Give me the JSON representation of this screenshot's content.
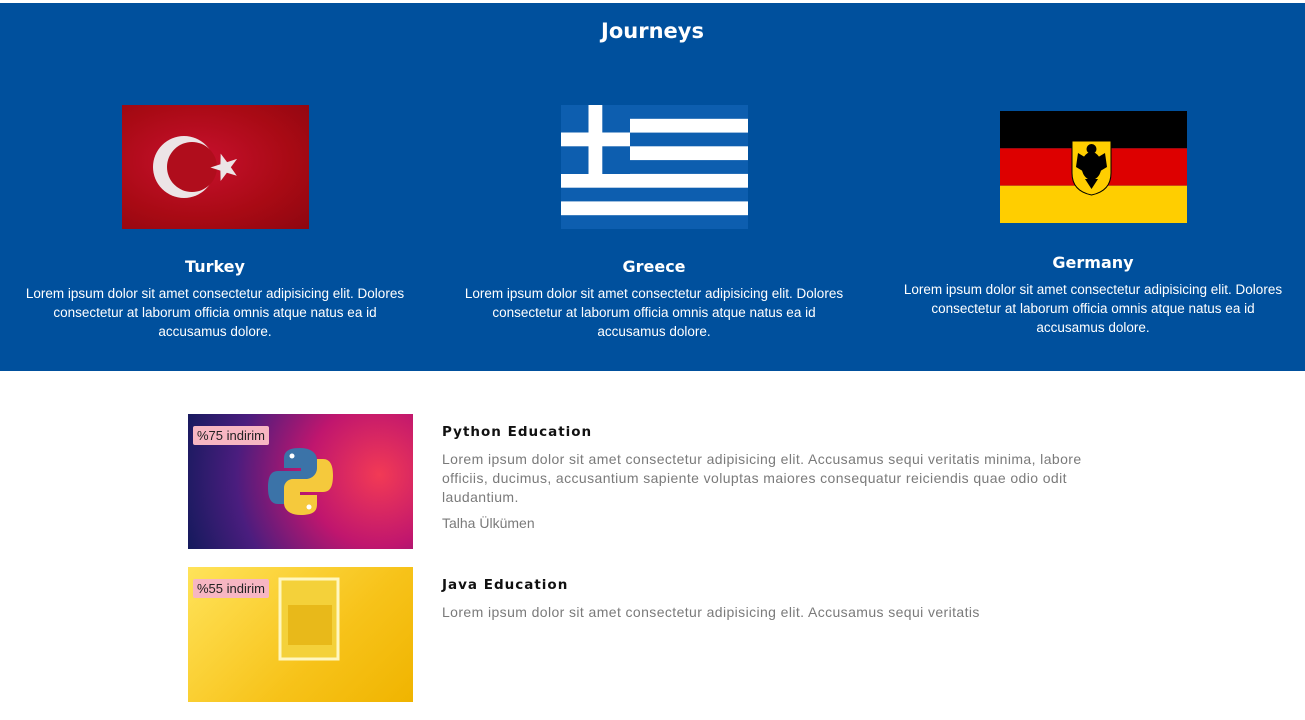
{
  "journeys": {
    "title": "Journeys",
    "countries": [
      {
        "name": "Turkey",
        "text": "Lorem ipsum dolor sit amet consectetur adipisicing elit. Dolores consectetur at laborum officia omnis atque natus ea id accusamus dolore."
      },
      {
        "name": "Greece",
        "text": "Lorem ipsum dolor sit amet consectetur adipisicing elit. Dolores consectetur at laborum officia omnis atque natus ea id accusamus dolore."
      },
      {
        "name": "Germany",
        "text": "Lorem ipsum dolor sit amet consectetur adipisicing elit. Dolores consectetur at laborum officia omnis atque natus ea id accusamus dolore."
      }
    ]
  },
  "courses": [
    {
      "badge": "%75 indirim",
      "title": "Python Education",
      "description": "Lorem ipsum dolor sit amet consectetur adipisicing elit. Accusamus sequi veritatis minima, labore officiis, ducimus, accusantium sapiente voluptas maiores consequatur reiciendis quae odio odit laudantium.",
      "author": "Talha Ülkümen"
    },
    {
      "badge": "%55 indirim",
      "title": "Java Education",
      "description": "Lorem ipsum dolor sit amet consectetur adipisicing elit. Accusamus sequi veritatis",
      "author": ""
    }
  ],
  "colors": {
    "banner": "#00509d",
    "badge": "#f7b6c2"
  }
}
